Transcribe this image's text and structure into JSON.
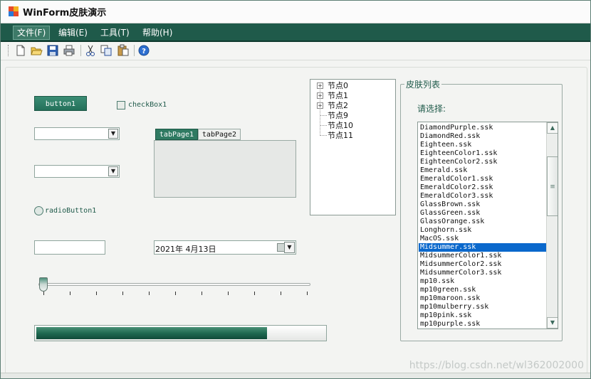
{
  "window": {
    "title": "WinForm皮肤演示"
  },
  "menu": {
    "items": [
      "文件(F)",
      "编辑(E)",
      "工具(T)",
      "帮助(H)"
    ]
  },
  "toolbar": {
    "buttons": [
      "new-icon",
      "open-icon",
      "save-icon",
      "print-icon",
      "cut-icon",
      "copy-icon",
      "paste-icon",
      "help-icon"
    ]
  },
  "controls": {
    "button1": "button1",
    "checkbox1": "checkBox1",
    "radiobutton1": "radioButton1",
    "tabs": [
      "tabPage1",
      "tabPage2"
    ],
    "date": "2021年  4月13日",
    "progress": 0.8
  },
  "tree": {
    "nodes": [
      "节点0",
      "节点1",
      "节点2",
      "节点9",
      "节点10",
      "节点11"
    ]
  },
  "skins": {
    "group_title": "皮肤列表",
    "prompt": "请选择:",
    "items": [
      "DiamondPurple.ssk",
      "DiamondRed.ssk",
      "Eighteen.ssk",
      "EighteenColor1.ssk",
      "EighteenColor2.ssk",
      "Emerald.ssk",
      "EmeraldColor1.ssk",
      "EmeraldColor2.ssk",
      "EmeraldColor3.ssk",
      "GlassBrown.ssk",
      "GlassGreen.ssk",
      "GlassOrange.ssk",
      "Longhorn.ssk",
      "MacOS.ssk",
      "Midsummer.ssk",
      "MidsummerColor1.ssk",
      "MidsummerColor2.ssk",
      "MidsummerColor3.ssk",
      "mp10.ssk",
      "mp10green.ssk",
      "mp10maroon.ssk",
      "mp10mulberry.ssk",
      "mp10pink.ssk",
      "mp10purple.ssk"
    ],
    "selected": "Midsummer.ssk"
  },
  "watermark": "https://blog.csdn.net/wl362002000",
  "colors": {
    "accent": "#1f5a4a",
    "selection": "#0a68cc"
  }
}
